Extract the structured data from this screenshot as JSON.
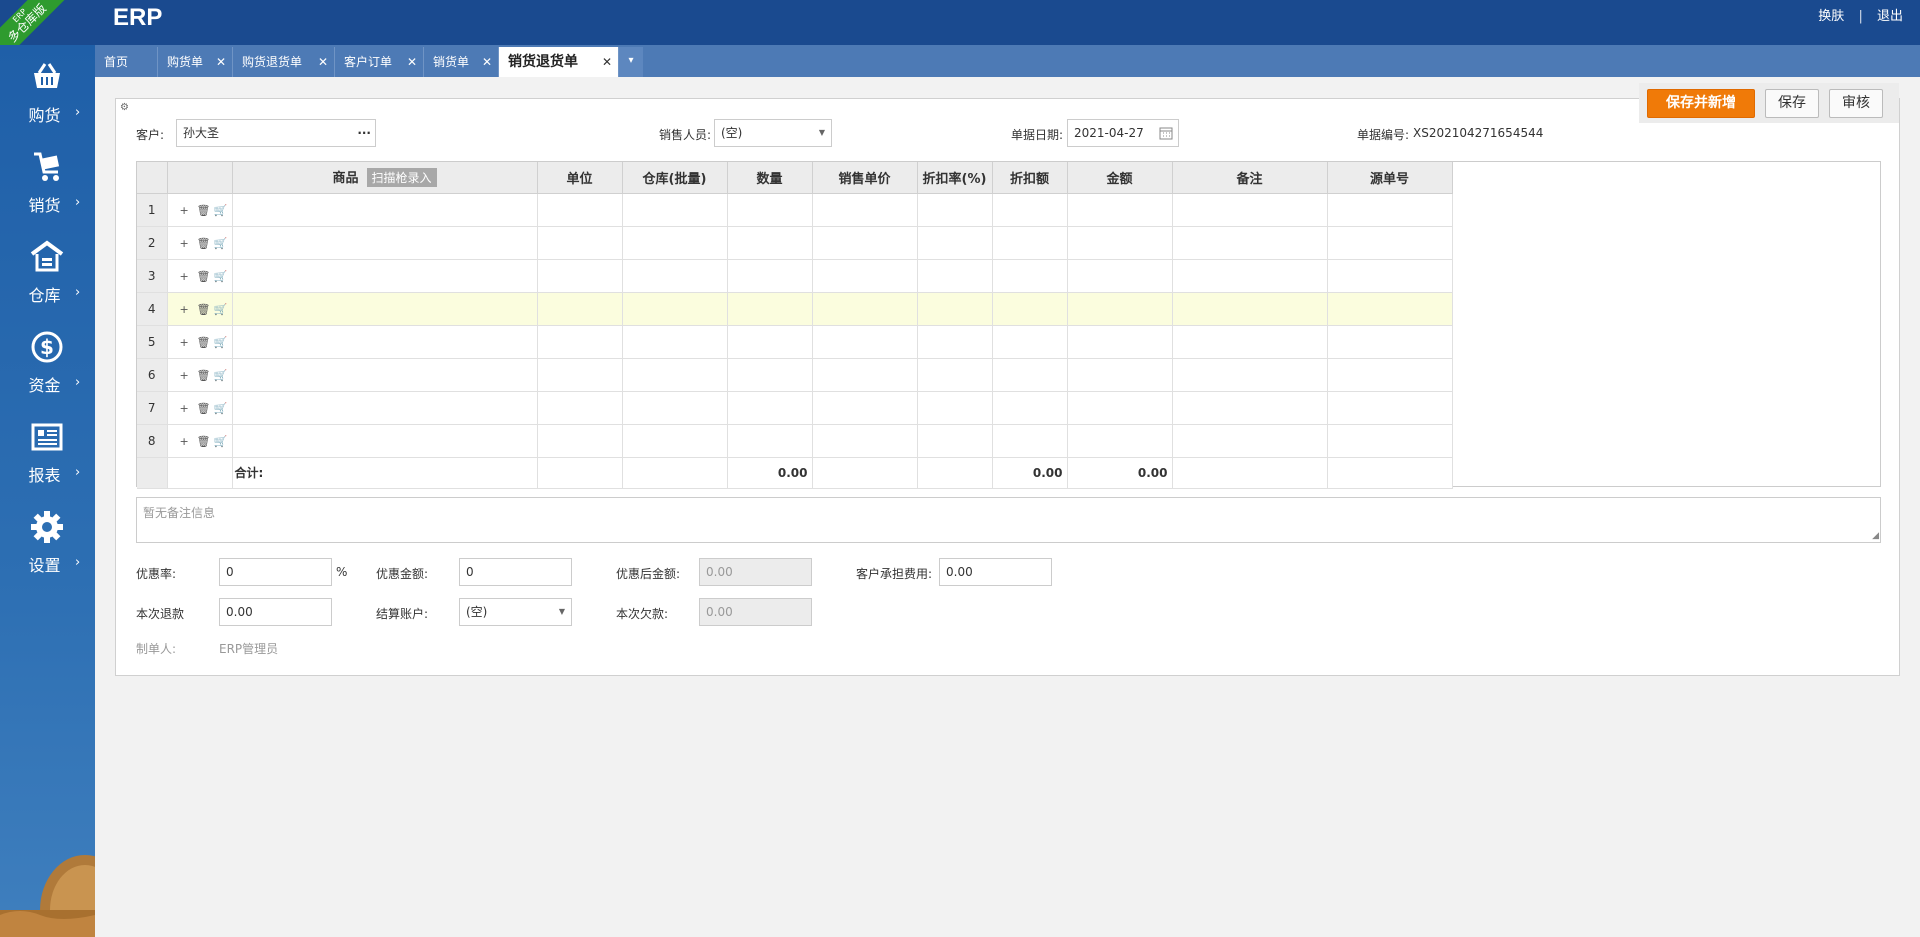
{
  "app": {
    "logo": "ERP",
    "edition_top": "ERP",
    "edition": "多仓库版"
  },
  "top_links": {
    "skin": "换肤",
    "separator": "|",
    "logout": "退出"
  },
  "sidebar": {
    "items": [
      {
        "label": "购货",
        "icon": "basket-icon"
      },
      {
        "label": "销货",
        "icon": "cart-icon"
      },
      {
        "label": "仓库",
        "icon": "warehouse-icon"
      },
      {
        "label": "资金",
        "icon": "dollar-icon"
      },
      {
        "label": "报表",
        "icon": "report-icon"
      },
      {
        "label": "设置",
        "icon": "gear-icon"
      }
    ],
    "chevron": "›"
  },
  "tabs": [
    {
      "label": "首页",
      "closable": false
    },
    {
      "label": "购货单",
      "closable": true
    },
    {
      "label": "购货退货单",
      "closable": true
    },
    {
      "label": "客户订单",
      "closable": true
    },
    {
      "label": "销货单",
      "closable": true
    },
    {
      "label": "销货退货单",
      "closable": true,
      "active": true
    }
  ],
  "tab_close": "✕",
  "tab_more": "▾",
  "toolbar": {
    "save_new": "保存并新增",
    "save": "保存",
    "audit": "审核"
  },
  "header": {
    "customer_label": "客户:",
    "customer_value": "孙大圣",
    "customer_more": "···",
    "salesperson_label": "销售人员:",
    "salesperson_value": "(空)",
    "date_label": "单据日期:",
    "date_value": "2021-04-27",
    "docno_label": "单据编号:",
    "docno_value": "XS202104271654544"
  },
  "grid": {
    "columns": [
      "",
      "",
      "商品",
      "单位",
      "仓库(批量)",
      "数量",
      "销售单价",
      "折扣率(%)",
      "折扣额",
      "金额",
      "备注",
      "源单号"
    ],
    "scan_button": "扫描枪录入",
    "rows": [
      "1",
      "2",
      "3",
      "4",
      "5",
      "6",
      "7",
      "8"
    ],
    "row_ops": {
      "add": "+",
      "delete": "🗑",
      "cart": "🛒"
    },
    "total_label": "合计:",
    "total_qty": "0.00",
    "total_discount": "0.00",
    "total_amount": "0.00"
  },
  "remark_placeholder": "暂无备注信息",
  "footer": {
    "discount_rate_label": "优惠率:",
    "discount_rate_value": "0",
    "percent": "%",
    "discount_amount_label": "优惠金额:",
    "discount_amount_value": "0",
    "after_discount_label": "优惠后金额:",
    "after_discount_value": "0.00",
    "customer_fee_label": "客户承担费用:",
    "customer_fee_value": "0.00",
    "refund_label": "本次退款",
    "refund_value": "0.00",
    "account_label": "结算账户:",
    "account_value": "(空)",
    "arrears_label": "本次欠款:",
    "arrears_value": "0.00",
    "maker_label": "制单人:",
    "maker_value": "ERP管理员"
  }
}
